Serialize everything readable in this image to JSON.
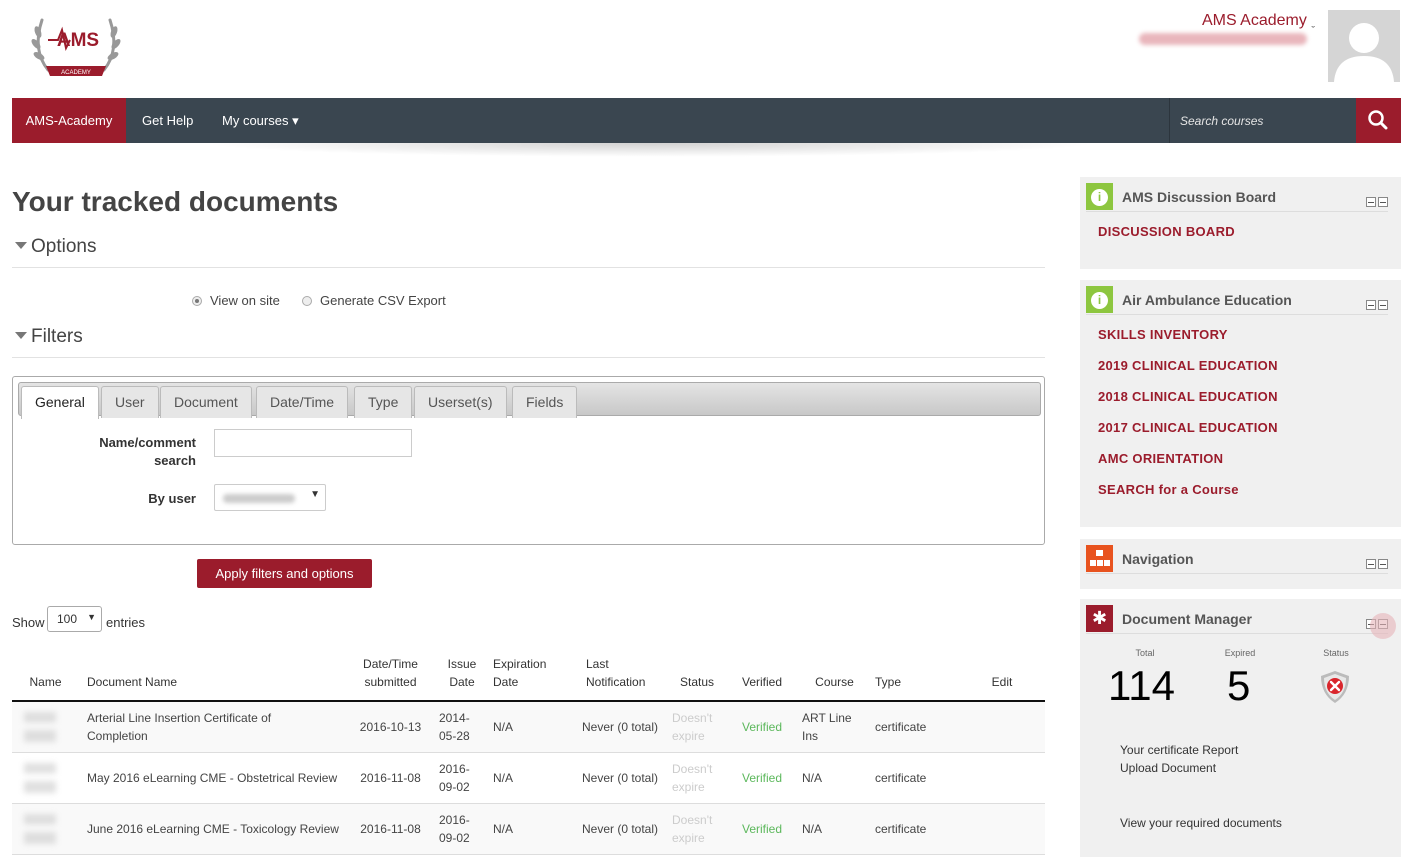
{
  "header": {
    "logo_text": "AMS",
    "logo_sub": "ACADEMY",
    "site_name": "AMS Academy",
    "caret": "ˬ"
  },
  "navbar": {
    "brand": "AMS-Academy",
    "get_help": "Get Help",
    "my_courses": "My courses ▾",
    "search_placeholder": "Search courses",
    "search_icon": "search-icon"
  },
  "page": {
    "title": "Your tracked documents"
  },
  "options": {
    "heading": "Options",
    "radio_view": "View on site",
    "radio_csv": "Generate CSV Export",
    "selected": "View on site"
  },
  "filters": {
    "heading": "Filters",
    "tabs": [
      "General",
      "User",
      "Document",
      "Date/Time",
      "Type",
      "Userset(s)",
      "Fields"
    ],
    "active_tab": "General",
    "name_label_1": "Name/comment",
    "name_label_2": "search",
    "name_value": "",
    "user_label": "By user",
    "apply_label": "Apply filters and options"
  },
  "table_controls": {
    "show_label": "Show",
    "length_value": "100",
    "entries_label": "entries"
  },
  "table": {
    "headers": {
      "name": "Name",
      "doc": "Document Name",
      "submitted_1": "Date/Time",
      "submitted_2": "submitted",
      "issue_1": "Issue",
      "issue_2": "Date",
      "exp_1": "Expiration",
      "exp_2": "Date",
      "notif_1": "Last",
      "notif_2": "Notification",
      "status": "Status",
      "verified": "Verified",
      "course": "Course",
      "type": "Type",
      "edit": "Edit"
    },
    "rows": [
      {
        "doc_1": "Arterial Line Insertion Certificate of",
        "doc_2": "Completion",
        "submitted": "2016-10-13",
        "issue_1": "2014-",
        "issue_2": "05-28",
        "expiration": "N/A",
        "notification": "Never (0 total)",
        "status_1": "Doesn't",
        "status_2": "expire",
        "verified": "Verified",
        "course_1": "ART Line",
        "course_2": "Ins",
        "type": "certificate"
      },
      {
        "doc_1": "May 2016 eLearning CME - Obstetrical Review",
        "doc_2": "",
        "submitted": "2016-11-08",
        "issue_1": "2016-",
        "issue_2": "09-02",
        "expiration": "N/A",
        "notification": "Never (0 total)",
        "status_1": "Doesn't",
        "status_2": "expire",
        "verified": "Verified",
        "course_1": "N/A",
        "course_2": "",
        "type": "certificate"
      },
      {
        "doc_1": "June 2016 eLearning CME - Toxicology Review",
        "doc_2": "",
        "submitted": "2016-11-08",
        "issue_1": "2016-",
        "issue_2": "09-02",
        "expiration": "N/A",
        "notification": "Never (0 total)",
        "status_1": "Doesn't",
        "status_2": "expire",
        "verified": "Verified",
        "course_1": "N/A",
        "course_2": "",
        "type": "certificate"
      }
    ]
  },
  "sidebar": {
    "discussion": {
      "title": "AMS Discussion Board",
      "icon": "info-icon",
      "links": [
        "DISCUSSION BOARD"
      ]
    },
    "air": {
      "title": "Air Ambulance Education",
      "icon": "info-icon",
      "links": [
        "SKILLS INVENTORY",
        "2019 CLINICAL EDUCATION",
        "2018 CLINICAL EDUCATION",
        "2017 CLINICAL EDUCATION",
        "AMC ORIENTATION",
        "SEARCH for a Course"
      ]
    },
    "navigation": {
      "title": "Navigation",
      "icon": "sitemap-icon"
    },
    "docmanager": {
      "title": "Document Manager",
      "icon": "asterisk-icon",
      "total_label": "Total",
      "total_value": "114",
      "expired_label": "Expired",
      "expired_value": "5",
      "status_label": "Status",
      "status_icon": "shield-error-icon",
      "links": [
        "Your certificate Report",
        "Upload Document",
        "View your required documents"
      ]
    }
  },
  "colors": {
    "brand": "#9b1c2c",
    "navbar": "#3a4650",
    "verified": "#5cb85c",
    "info_green": "#8dc63f",
    "nav_orange": "#e8531f"
  }
}
